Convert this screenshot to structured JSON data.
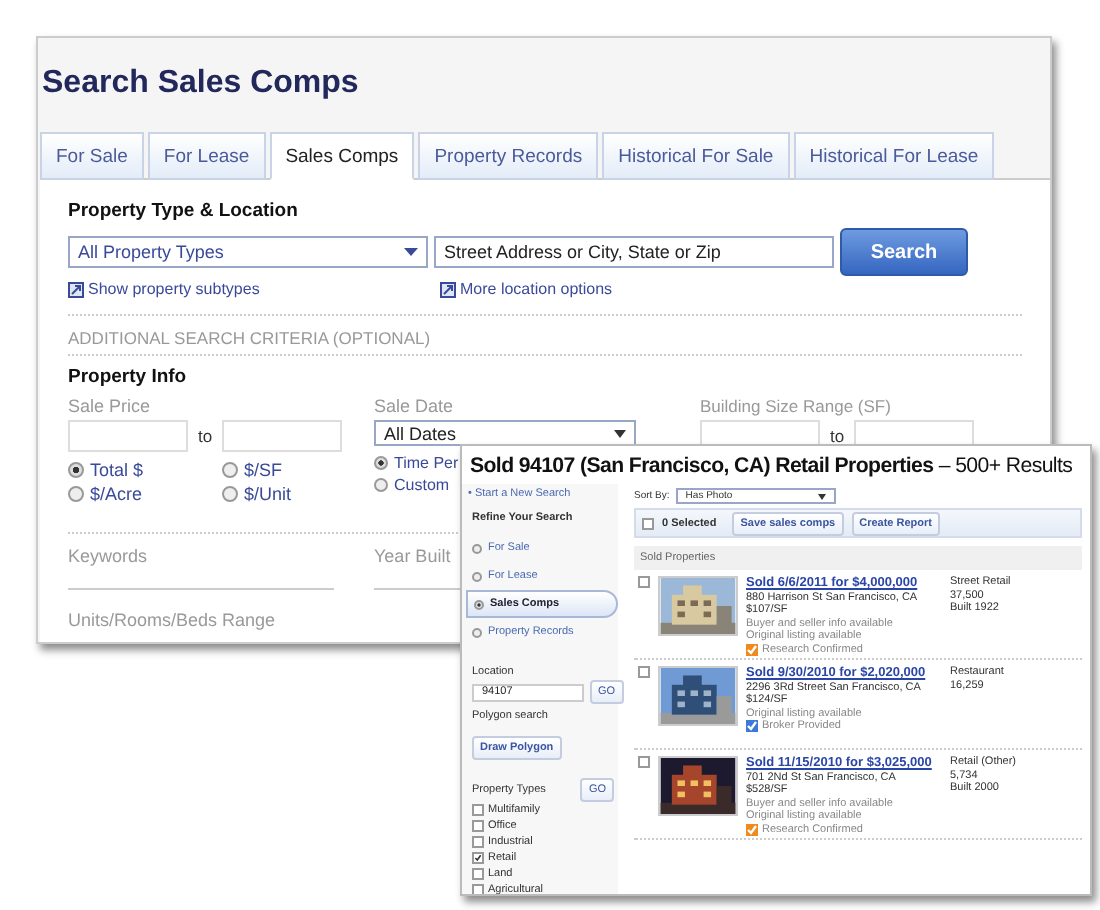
{
  "search_window": {
    "title": "Search Sales Comps",
    "tabs": [
      {
        "label": "For Sale",
        "selected": false
      },
      {
        "label": "For Lease",
        "selected": false
      },
      {
        "label": "Sales Comps",
        "selected": true
      },
      {
        "label": "Property Records",
        "selected": false
      },
      {
        "label": "Historical For Sale",
        "selected": false
      },
      {
        "label": "Historical For Lease",
        "selected": false
      }
    ],
    "location": {
      "heading": "Property Type & Location",
      "property_type": "All Property Types",
      "address_placeholder": "Street Address or City, State or Zip",
      "search_button": "Search",
      "links": [
        "Show property subtypes",
        "More location options"
      ]
    },
    "additional_heading": "ADDITIONAL SEARCH CRITERIA (OPTIONAL)",
    "property_info": {
      "heading": "Property Info",
      "sale_price": {
        "label": "Sale Price",
        "to": "to",
        "units": [
          {
            "label": "Total $",
            "selected": true
          },
          {
            "label": "$/SF",
            "selected": false
          },
          {
            "label": "$/Acre",
            "selected": false
          },
          {
            "label": "$/Unit",
            "selected": false
          }
        ]
      },
      "sale_date": {
        "label": "Sale Date",
        "value": "All Dates",
        "options": [
          {
            "label": "Time Per",
            "selected": true
          },
          {
            "label": "Custom",
            "selected": false
          }
        ]
      },
      "building_size": {
        "label": "Building Size Range (SF)",
        "to": "to"
      },
      "keywords": {
        "label": "Keywords"
      },
      "year_built": {
        "label": "Year Built"
      },
      "units_range": {
        "label": "Units/Rooms/Beds Range"
      }
    }
  },
  "results_window": {
    "title": "Sold 94107 (San Francisco, CA) Retail Properties",
    "result_count": "– 500+ Results",
    "sidebar": {
      "new_search": "• Start a New Search",
      "refine_heading": "Refine Your Search",
      "categories": [
        {
          "label": "For Sale",
          "selected": false
        },
        {
          "label": "For Lease",
          "selected": false
        },
        {
          "label": "Sales Comps",
          "selected": true
        },
        {
          "label": "Property Records",
          "selected": false
        }
      ],
      "location_label": "Location",
      "location_value": "94107",
      "go": "GO",
      "polygon_label": "Polygon search",
      "polygon_button": "Draw Polygon",
      "types_label": "Property Types",
      "types_go": "GO",
      "types": [
        {
          "label": "Multifamily",
          "checked": false
        },
        {
          "label": "Office",
          "checked": false
        },
        {
          "label": "Industrial",
          "checked": false
        },
        {
          "label": "Retail",
          "checked": true
        },
        {
          "label": "Land",
          "checked": false
        },
        {
          "label": "Agricultural",
          "checked": false
        }
      ]
    },
    "sort_label": "Sort By:",
    "sort_value": "Has Photo",
    "toolbar": {
      "selected_count": "0 Selected",
      "all_checked": false,
      "buttons": [
        "Save sales comps",
        "Create Report"
      ]
    },
    "list_heading": "Sold Properties",
    "results": [
      {
        "checked": false,
        "link": "Sold 6/6/2011 for $4,000,000",
        "details": [
          "880 Harrison St San Francisco, CA",
          "$107/SF"
        ],
        "notes": [
          "Buyer and seller info available",
          "Original listing available"
        ],
        "source": {
          "label": "Research Confirmed",
          "kind": "research"
        },
        "facts": [
          "Street Retail",
          "37,500",
          "Built 1922"
        ]
      },
      {
        "checked": false,
        "link": "Sold 9/30/2010 for $2,020,000",
        "details": [
          "2296 3Rd Street San Francisco, CA",
          "$124/SF"
        ],
        "notes": [
          "Original listing available"
        ],
        "source": {
          "label": "Broker Provided",
          "kind": "broker"
        },
        "facts": [
          "Restaurant",
          "16,259"
        ]
      },
      {
        "checked": false,
        "link": "Sold 11/15/2010 for $3,025,000",
        "details": [
          "701 2Nd St San Francisco, CA",
          "$528/SF"
        ],
        "notes": [
          "Buyer and seller info available",
          "Original listing available"
        ],
        "source": {
          "label": "Research Confirmed",
          "kind": "research"
        },
        "facts": [
          "Retail (Other)",
          "5,734",
          "Built 2000"
        ]
      }
    ]
  }
}
